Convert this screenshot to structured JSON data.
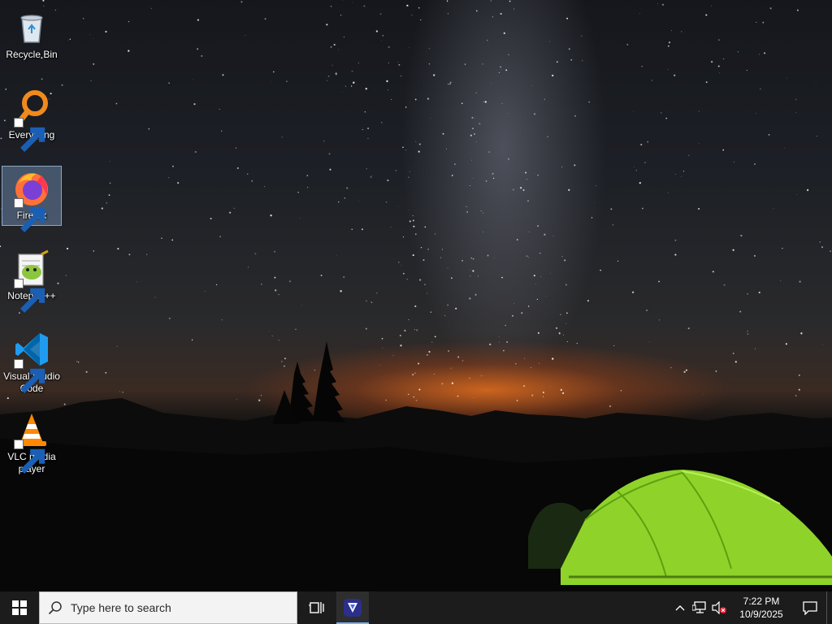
{
  "desktop": {
    "icons": [
      {
        "label": "Recycle Bin",
        "icon": "recycle-bin-icon",
        "shortcut": false,
        "selected": false
      },
      {
        "label": "Everything",
        "icon": "everything-search-icon",
        "shortcut": true,
        "selected": false
      },
      {
        "label": "Firefox",
        "icon": "firefox-icon",
        "shortcut": true,
        "selected": true
      },
      {
        "label": "Notepad++",
        "icon": "notepad-plus-plus-icon",
        "shortcut": true,
        "selected": false
      },
      {
        "label": "Visual Studio Code",
        "icon": "vscode-icon",
        "shortcut": true,
        "selected": false
      },
      {
        "label": "VLC media player",
        "icon": "vlc-icon",
        "shortcut": true,
        "selected": false
      }
    ]
  },
  "taskbar": {
    "search_placeholder": "Type here to search",
    "clock": {
      "time": "7:22 PM",
      "date": "10/9/2025"
    },
    "colors": {
      "background": "#1c1c1c",
      "accent": "#7aaef0"
    }
  }
}
